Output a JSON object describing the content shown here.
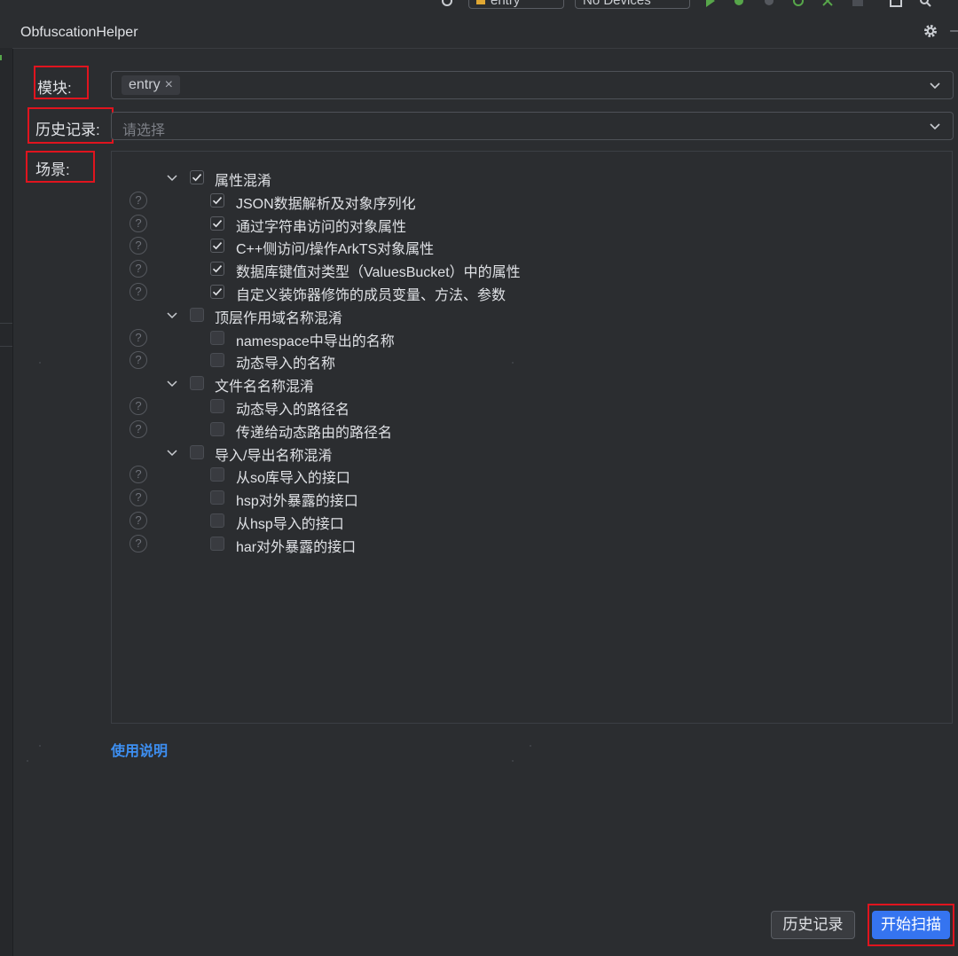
{
  "toolbar": {
    "module_selector": "entry",
    "device_selector": "No Devices"
  },
  "panel": {
    "title": "ObfuscationHelper"
  },
  "form": {
    "module_label": "模块:",
    "module_chip": "entry",
    "module_chip_remove": "×",
    "history_label": "历史记录:",
    "history_placeholder": "请选择",
    "scenario_label": "场景:"
  },
  "scenarios": [
    {
      "label": "属性混淆",
      "checked": true,
      "expanded": true,
      "children": [
        {
          "label": "JSON数据解析及对象序列化",
          "checked": true
        },
        {
          "label": "通过字符串访问的对象属性",
          "checked": true
        },
        {
          "label": "C++侧访问/操作ArkTS对象属性",
          "checked": true
        },
        {
          "label": "数据库键值对类型（ValuesBucket）中的属性",
          "checked": true
        },
        {
          "label": "自定义装饰器修饰的成员变量、方法、参数",
          "checked": true
        }
      ]
    },
    {
      "label": "顶层作用域名称混淆",
      "checked": false,
      "expanded": true,
      "children": [
        {
          "label": "namespace中导出的名称",
          "checked": false
        },
        {
          "label": "动态导入的名称",
          "checked": false
        }
      ]
    },
    {
      "label": "文件名名称混淆",
      "checked": false,
      "expanded": true,
      "children": [
        {
          "label": "动态导入的路径名",
          "checked": false
        },
        {
          "label": "传递给动态路由的路径名",
          "checked": false
        }
      ]
    },
    {
      "label": "导入/导出名称混淆",
      "checked": false,
      "expanded": true,
      "children": [
        {
          "label": "从so库导入的接口",
          "checked": false
        },
        {
          "label": "hsp对外暴露的接口",
          "checked": false
        },
        {
          "label": "从hsp导入的接口",
          "checked": false
        },
        {
          "label": "har对外暴露的接口",
          "checked": false
        }
      ]
    }
  ],
  "help_glyph": "?",
  "usage_link": "使用说明",
  "buttons": {
    "history": "历史记录",
    "start_scan": "开始扫描"
  },
  "colors": {
    "background": "#2b2d30",
    "accent": "#3574f0",
    "link": "#3d8ff2",
    "highlight_box": "#e0141e"
  }
}
